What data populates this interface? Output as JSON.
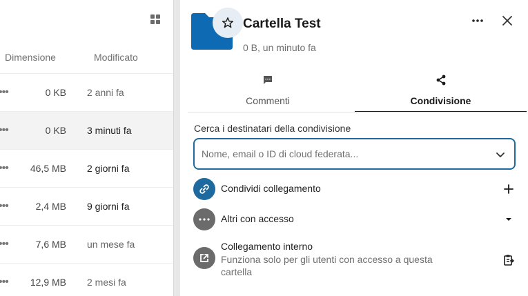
{
  "file_list": {
    "columns": {
      "size": "Dimensione",
      "modified": "Modificato"
    },
    "rows": [
      {
        "size": "0 KB",
        "modified": "2 anni fa",
        "selected": false
      },
      {
        "size": "0 KB",
        "modified": "3 minuti fa",
        "selected": true
      },
      {
        "size": "46,5 MB",
        "modified": "2 giorni fa",
        "selected": false
      },
      {
        "size": "2,4 MB",
        "modified": "9 giorni fa",
        "selected": false
      },
      {
        "size": "7,6 MB",
        "modified": "un mese fa",
        "selected": false
      },
      {
        "size": "12,9 MB",
        "modified": "2 mesi fa",
        "selected": false
      }
    ],
    "row_menu_glyph": "•••"
  },
  "sidebar": {
    "title": "Cartella Test",
    "subtitle": "0 B, un minuto fa",
    "tabs": [
      {
        "label": "Commenti",
        "icon": "comment-icon",
        "active": false
      },
      {
        "label": "Condivisione",
        "icon": "share-icon",
        "active": true
      }
    ],
    "search": {
      "label": "Cerca i destinatari della condivisione",
      "placeholder": "Nome, email o ID di cloud federata...",
      "value": ""
    },
    "share_link": {
      "label": "Condividi collegamento",
      "icon": "link-icon",
      "action_icon": "plus-icon"
    },
    "others_access": {
      "label": "Altri con accesso",
      "icon": "dots-icon",
      "action_icon": "caret-down-icon"
    },
    "internal_link": {
      "label": "Collegamento interno",
      "description": "Funziona solo per gli utenti con accesso a questa cartella",
      "icon": "external-link-icon",
      "action_icon": "clipboard-icon"
    }
  },
  "colors": {
    "accent": "#1e6a9e",
    "folder": "#0f6ab4",
    "neutral_avatar": "#6b6b6b",
    "selected_row": "#f3f3f3"
  }
}
